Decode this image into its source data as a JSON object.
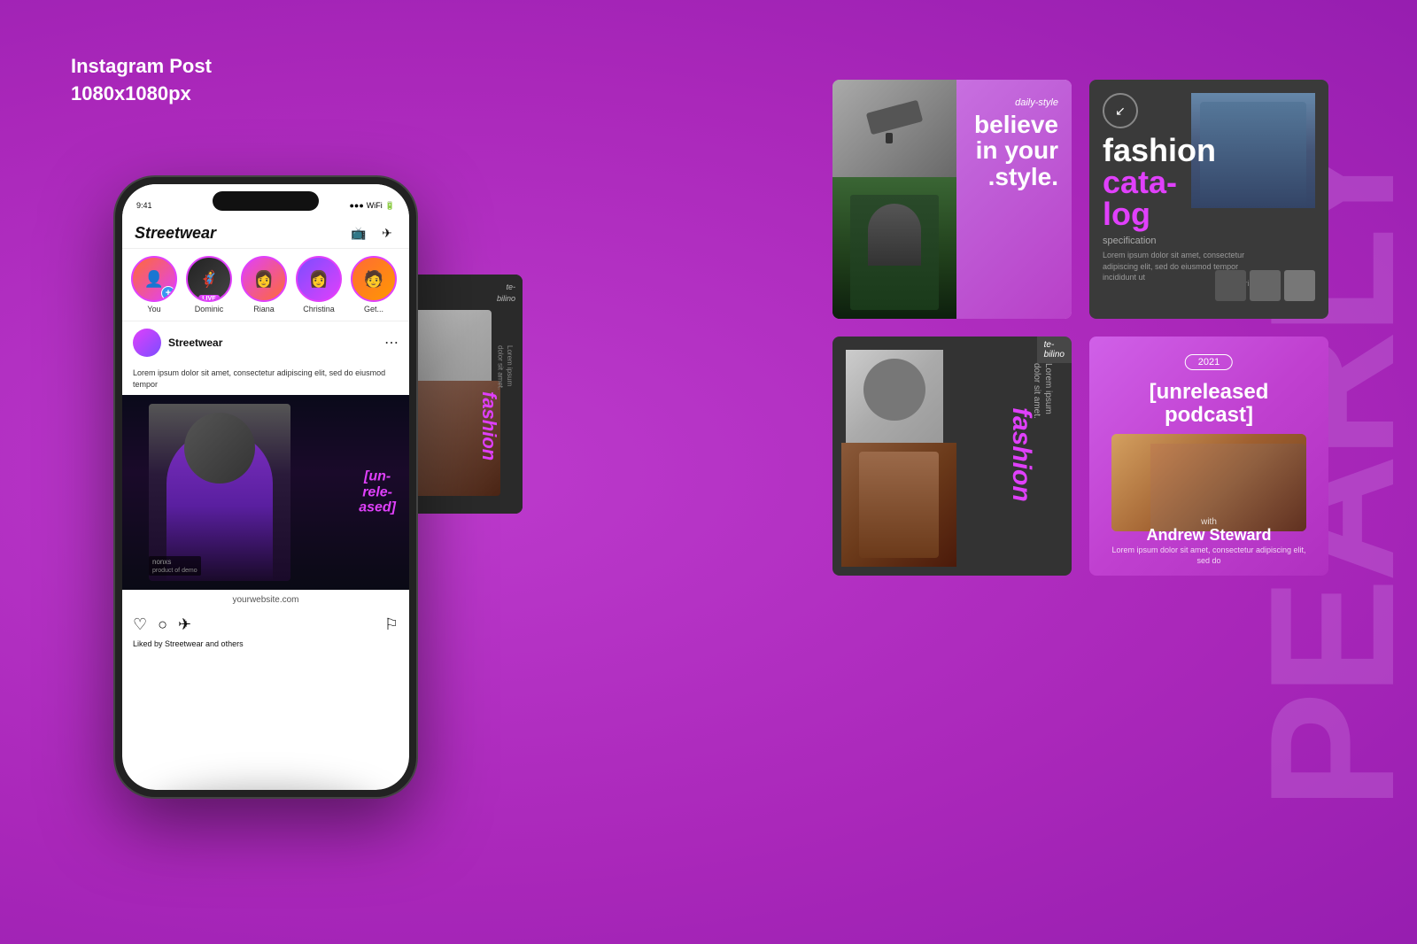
{
  "page": {
    "title": "Instagram Post",
    "dimensions": "1080x1080px",
    "background_color": "#b832c8"
  },
  "bg_text": "PEARLY",
  "phone": {
    "stories": [
      {
        "id": "you",
        "label": "You",
        "has_plus": true
      },
      {
        "id": "dominic",
        "label": "Dominic",
        "has_live": true
      },
      {
        "id": "riana",
        "label": "Riana",
        "has_live": false
      },
      {
        "id": "christina",
        "label": "Christina",
        "has_live": false
      },
      {
        "id": "get",
        "label": "Get...",
        "has_live": false
      }
    ],
    "post": {
      "username": "Streetwear",
      "caption": "Lorem ipsum dolor sit amet, consectetur\nadipiscing elit, sed do eiusmod tempor",
      "overlay_text": "[un-\nrele-\nased]",
      "website": "yourwebsite.com",
      "liked_by": "Liked by Streetwear and others"
    }
  },
  "cards": {
    "card1": {
      "subtitle": "daily-style",
      "title": "believe\nin your\n.style.",
      "bg_color": "#c860d8"
    },
    "card2": {
      "logo_text": "↙",
      "title_part1": "fashion",
      "title_part2": "cata-",
      "title_part3": "log",
      "spec_label": "specification",
      "variants_label": "variants.",
      "body_text": "Lorem ipsum dolor sit amet,\nconsectetur adipiscing elit, sed do\neiusmod tempor incididunt ut"
    },
    "card3": {
      "tag": "te-\nbilino",
      "side_text": "Lorem ipsum\ndolor sit amet.",
      "fashion_text": "fashion",
      "bg_color": "#333333"
    },
    "card4": {
      "year": "2021",
      "title": "[unreleased\npodcast]",
      "with_text": "with",
      "name": "Andrew Steward",
      "desc": "Lorem ipsum dolor sit amet,\nconsectetur adipiscing elit, sed do"
    }
  }
}
